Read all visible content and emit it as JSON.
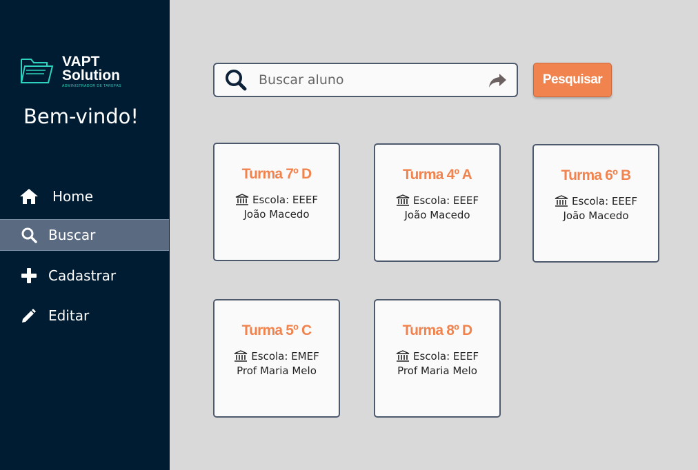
{
  "brand": {
    "title_line1": "VAPT",
    "title_line2": "Solution",
    "subtitle": "ADMINISTRADOR DE TAREFAS",
    "accent": "#2ed3c0"
  },
  "sidebar": {
    "welcome": "Bem-vindo!",
    "items": [
      {
        "label": "Home",
        "icon": "home-icon",
        "active": false
      },
      {
        "label": "Buscar",
        "icon": "search-icon",
        "active": true
      },
      {
        "label": "Cadastrar",
        "icon": "plus-icon",
        "active": false
      },
      {
        "label": "Editar",
        "icon": "pencil-icon",
        "active": false
      }
    ]
  },
  "search": {
    "placeholder": "Buscar aluno",
    "value": "",
    "button_label": "Pesquisar",
    "button_color": "#f0834e"
  },
  "cards": [
    {
      "title": "Turma 7º D",
      "school": "Escola: EEEF",
      "teacher": "João Macedo"
    },
    {
      "title": "Turma 4º A",
      "school": "Escola: EEEF",
      "teacher": "João Macedo"
    },
    {
      "title": "Turma 6º B",
      "school": "Escola: EEEF",
      "teacher": "João Macedo"
    },
    {
      "title": "Turma 5º C",
      "school": "Escola: EMEF",
      "teacher": "Prof Maria Melo"
    },
    {
      "title": "Turma 8º D",
      "school": "Escola: EEEF",
      "teacher": "Prof Maria Melo"
    }
  ],
  "colors": {
    "sidebar_bg": "#001c33",
    "active_item": "#5a6a80",
    "page_bg": "#d9d9d9",
    "card_title": "#f0834e"
  }
}
